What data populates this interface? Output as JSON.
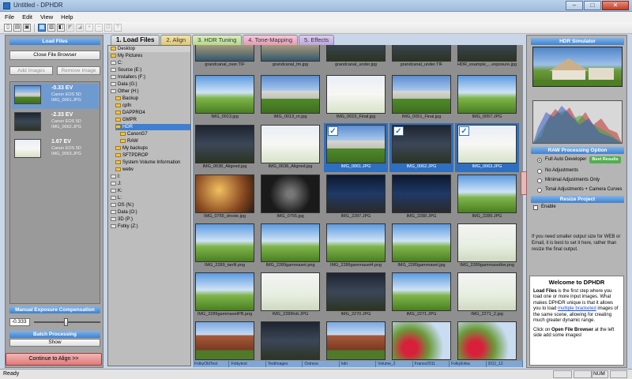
{
  "window": {
    "title": "Untitled - DPHDR"
  },
  "menu": [
    "File",
    "Edit",
    "View",
    "Help"
  ],
  "left": {
    "load_files_header": "Load Files",
    "close_browser": "Close File Browser",
    "add_images": "Add Images",
    "remove_image": "Remove Image",
    "images": [
      {
        "ev": "-0.33 EV",
        "camera": "Canon EOS 5D",
        "file": "IMG_0061.JPG",
        "selected": true
      },
      {
        "ev": "-2.33 EV",
        "camera": "Canon EOS 5D",
        "file": "IMG_0062.JPG",
        "selected": false
      },
      {
        "ev": "1.67 EV",
        "camera": "Canon EOS 5D",
        "file": "IMG_0063.JPG",
        "selected": false
      }
    ],
    "exposure_header": "Manual Exposure Compensation",
    "exposure_value": "-0.333",
    "batch_header": "Batch Processing",
    "batch_show": "Show",
    "continue": "Continue to Align >>"
  },
  "tabs": [
    "1. Load Files",
    "2. Align",
    "3. HDR Tuning",
    "4. Tone-Mapping",
    "5. Effects"
  ],
  "tree": [
    "Desktop",
    "My Pictures",
    "C:",
    "Source (E:)",
    "Installers (F:)",
    "Data (G:)",
    "Other (H:)",
    "Backup",
    "cpfn",
    "DAPPRO4",
    "GMPR",
    "HDR",
    "CanonG7",
    "RAW",
    "My backups",
    "SFTPDROP",
    "System Volume Information",
    "webv",
    "I:",
    "J:",
    "K:",
    "L:",
    "OS (N:)",
    "Data (O:)",
    "3D (P:)",
    "Fotky (Z:)"
  ],
  "grid": [
    [
      "grandcanal_over.TIF",
      "grandcanal_tm.jpg",
      "grandcanal_under.jpg",
      "grandcanal_under.TIF",
      "HDR_example_...exposure.jpg"
    ],
    [
      "IMG_0013.jpg",
      "IMG_0013_m.jpg",
      "IMG_0015_Final.jpg",
      "IMG_0051_Final.jpg",
      "IMG_0057.JPG"
    ],
    [
      "IMG_0638_Aligned.jpg",
      "IMG_0638_Aligned.jpg",
      "IMG_0061.JPG",
      "IMG_0062.JPG",
      "IMG_0063.JPG"
    ],
    [
      "IMG_0755_droste.jpg",
      "IMG_0755.jpg",
      "IMG_2287.JPG",
      "IMG_2288.JPG",
      "IMG_2289.JPG"
    ],
    [
      "IMG_2289_tanfil.png",
      "IMG_2289gammaset.png",
      "IMG_2289gammaset4.png",
      "IMG_2289gammaset.jpg",
      "IMG_2289gammasetbw.png"
    ],
    [
      "IMG_2289gammasetPB.png",
      "IMG_2289hdr.JPG",
      "IMG_2270.JPG",
      "IMG_2271.JPG",
      "IMG_2271_2.jpg"
    ],
    [
      "",
      "",
      "",
      "",
      ""
    ]
  ],
  "bottom_folders": [
    "FotkyOldTest",
    "Fotkytest",
    "TestImages",
    "Ostrava",
    "hdri",
    "Volume_2",
    "France2011",
    "FotkyErika",
    "2011_12"
  ],
  "right": {
    "simulator_header": "HDR Simulator",
    "raw_header": "RAW Processing Option",
    "options": [
      "Full Auto Developer",
      "No Adjustments",
      "Minimal Adjustments Only",
      "Tonal Adjustments + Camera Curves"
    ],
    "best_results": "Best Results",
    "resize_header": "Resize Project",
    "enable": "Enable",
    "hint": "If you need smaller output size for WEB or Email, it is best to set it here, rather than resize the final output.",
    "welcome_title": "Welcome to DPHDR",
    "welcome_p1_bold": "Load Files",
    "welcome_p1": " is the first step where you load one or more input images. What makes DPHDR unique is that it allows you to load ",
    "welcome_link": "multiple bracketed",
    "welcome_p1_end": " images of the same scene, allowing for creating much greater dynamic range.",
    "welcome_p2_a": "Click on ",
    "welcome_p2_bold": "Open File Browser",
    "welcome_p2_b": " at the left side add some images!"
  },
  "status": {
    "text": "Ready",
    "num": "NUM"
  }
}
